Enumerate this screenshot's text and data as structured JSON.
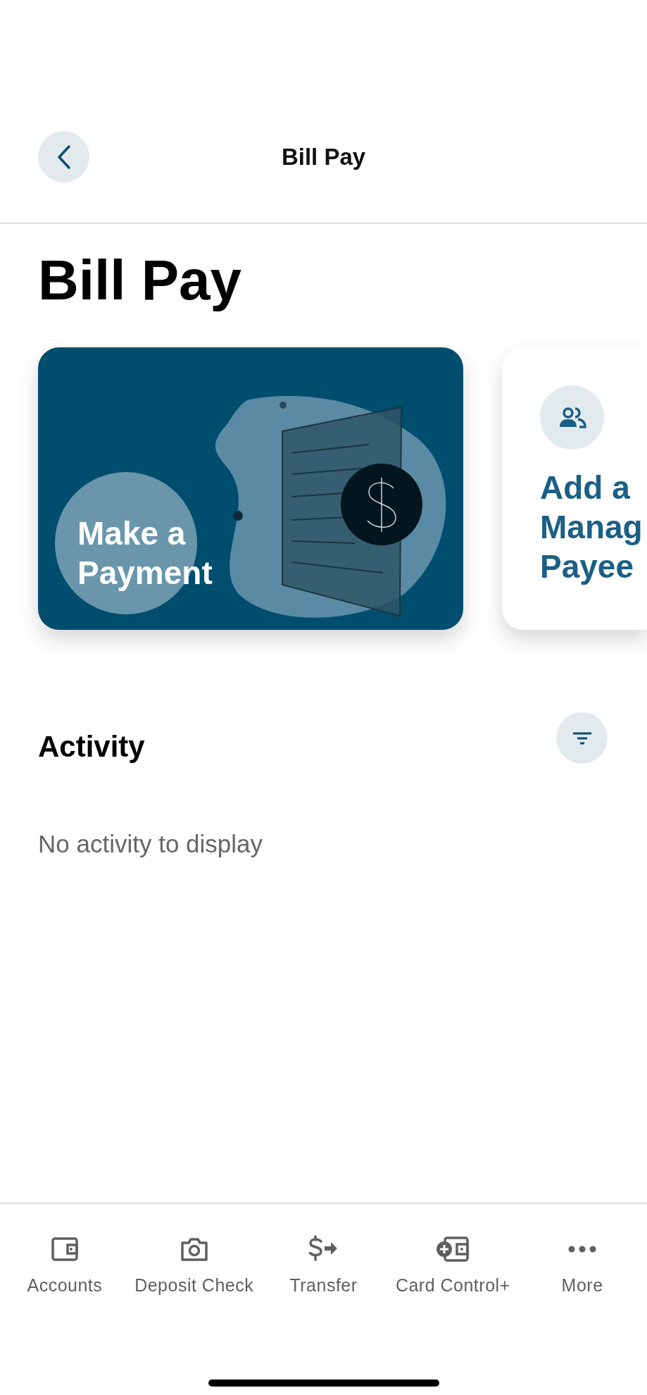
{
  "header": {
    "title": "Bill Pay"
  },
  "page_title": "Bill Pay",
  "cards": [
    {
      "kind": "illustrated",
      "lines": [
        "Make a",
        "Payment"
      ]
    },
    {
      "kind": "icon",
      "lines": [
        "Add a",
        "Manag",
        "Payee"
      ]
    }
  ],
  "activity": {
    "title": "Activity",
    "empty_message": "No activity to display"
  },
  "tab_bar": [
    {
      "label": "Accounts"
    },
    {
      "label": "Deposit Check"
    },
    {
      "label": "Transfer"
    },
    {
      "label": "Card Control+"
    },
    {
      "label": "More"
    }
  ]
}
